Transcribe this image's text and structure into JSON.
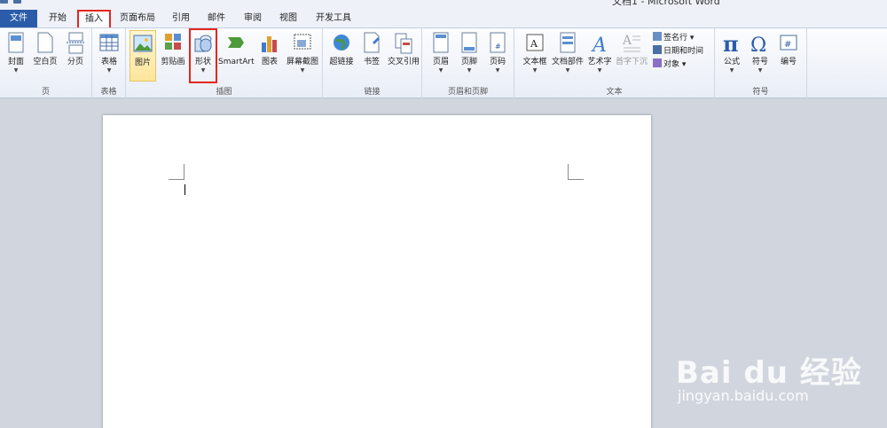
{
  "window": {
    "title": "文档1 - Microsoft Word"
  },
  "tabs": [
    {
      "label": "文件"
    },
    {
      "label": "开始"
    },
    {
      "label": "插入"
    },
    {
      "label": "页面布局"
    },
    {
      "label": "引用"
    },
    {
      "label": "邮件"
    },
    {
      "label": "审阅"
    },
    {
      "label": "视图"
    },
    {
      "label": "开发工具"
    }
  ],
  "ribbon": {
    "pages": {
      "name": "页",
      "cover": "封面",
      "blank": "空白页",
      "break": "分页"
    },
    "tables": {
      "name": "表格",
      "table": "表格"
    },
    "illustrations": {
      "name": "插图",
      "picture": "图片",
      "clipart": "剪贴画",
      "shapes": "形状",
      "smartart": "SmartArt",
      "chart": "图表",
      "screenshot": "屏幕截图"
    },
    "links": {
      "name": "链接",
      "hyperlink": "超链接",
      "bookmark": "书签",
      "crossref": "交叉引用"
    },
    "headerfooter": {
      "name": "页眉和页脚",
      "header": "页眉",
      "footer": "页脚",
      "pagenum": "页码"
    },
    "text": {
      "name": "文本",
      "textbox": "文本框",
      "quickparts": "文档部件",
      "wordart": "艺术字",
      "dropcap": "首字下沉",
      "signature": "签名行",
      "datetime": "日期和时间",
      "object": "对象"
    },
    "symbols": {
      "name": "符号",
      "equation": "公式",
      "symbol": "符号",
      "number": "编号"
    }
  },
  "watermark": {
    "logo": "Bai du 经验",
    "url": "jingyan.baidu.com"
  },
  "colors": {
    "file_tab": "#2a5caa",
    "highlight_box": "#e5261f",
    "pressed": "#fde59a"
  }
}
